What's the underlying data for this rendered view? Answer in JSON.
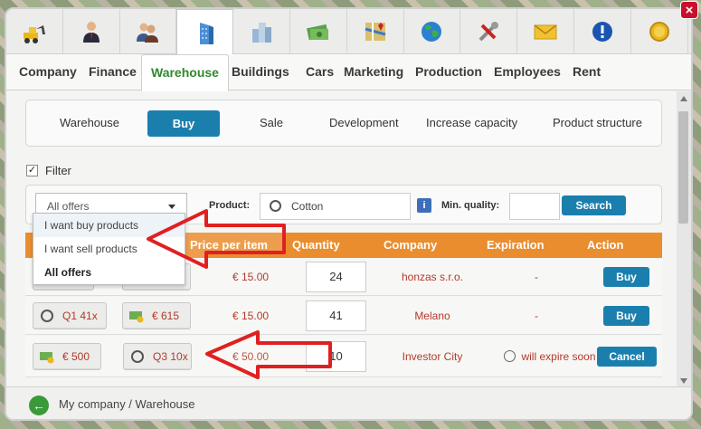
{
  "icons": [
    "excavator-icon",
    "businessman-icon",
    "people-icon",
    "warehouse-building-icon",
    "office-buildings-icon",
    "money-icon",
    "map-icon",
    "globe-icon",
    "tools-icon",
    "mail-icon",
    "alert-icon",
    "coin-icon"
  ],
  "tabs": [
    "Company",
    "Finance",
    "Warehouse",
    "Buildings",
    "Cars",
    "Marketing",
    "Production",
    "Employees",
    "Rent"
  ],
  "subnav": [
    "Warehouse",
    "Buy",
    "Sale",
    "Development",
    "Increase capacity",
    "Product structure"
  ],
  "filter_label": "Filter",
  "offers_select": "All offers",
  "product_label": "Product:",
  "product_value": "Cotton",
  "quality_label": "Min. quality:",
  "search_label": "Search",
  "columns": [
    "Price per item",
    "Quantity",
    "Company",
    "Expiration",
    "Action"
  ],
  "dropdown_options": [
    "I want buy products",
    "I want sell products",
    "All offers"
  ],
  "rows": [
    {
      "chip1": "",
      "chip2": "",
      "price": "€ 15.00",
      "qty": "24",
      "company": "honzas s.r.o.",
      "exp": "-",
      "action": "Buy"
    },
    {
      "chip1": "Q1 41x",
      "chip2": "€ 615",
      "price": "€ 15.00",
      "qty": "41",
      "company": "Melano",
      "exp": "-",
      "action": "Buy"
    },
    {
      "chip1": "€ 500",
      "chip2": "Q3 10x",
      "price": "€ 50.00",
      "qty": "10",
      "company": "Investor City",
      "exp": "will expire soon",
      "action": "Cancel"
    }
  ],
  "breadcrumb": "My company / Warehouse",
  "colors": {
    "accent": "#1b7fae",
    "header": "#e98d2f",
    "tab_active": "#2e8a2e",
    "arrow": "#e02020"
  }
}
